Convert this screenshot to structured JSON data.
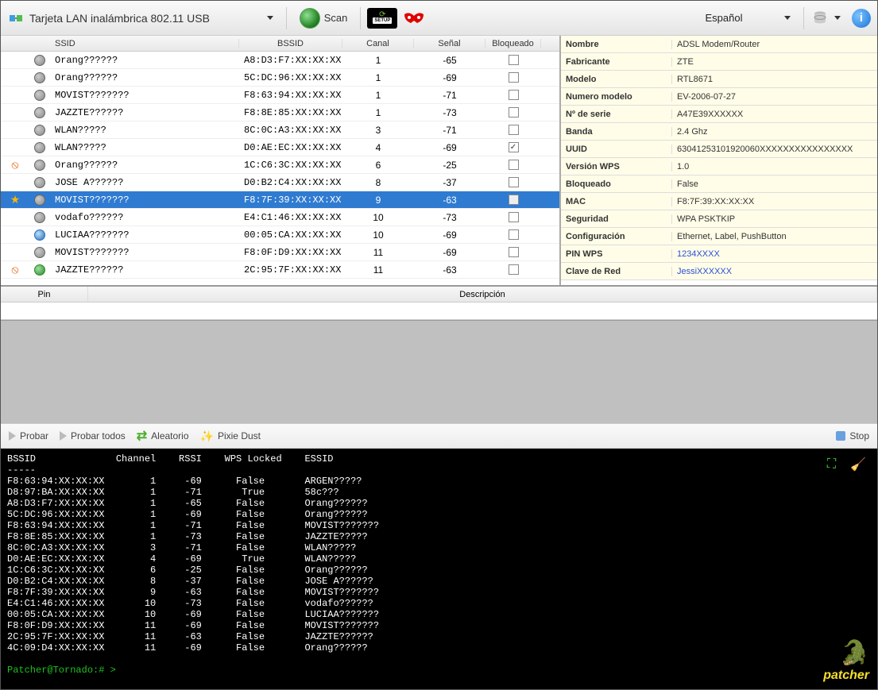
{
  "toolbar": {
    "adapter": "Tarjeta LAN inalámbrica 802.11 USB",
    "scan": "Scan",
    "language": "Español"
  },
  "grid": {
    "headers": {
      "ssid": "SSID",
      "bssid": "BSSID",
      "channel": "Canal",
      "signal": "Señal",
      "locked": "Bloqueado"
    },
    "rows": [
      {
        "ic1": "",
        "ic2": "dot",
        "ssid": "Orang??????",
        "bssid": "A8:D3:F7:XX:XX:XX",
        "ch": "1",
        "sig": "-65",
        "lock": false,
        "sel": false
      },
      {
        "ic1": "",
        "ic2": "dot",
        "ssid": "Orang??????",
        "bssid": "5C:DC:96:XX:XX:XX",
        "ch": "1",
        "sig": "-69",
        "lock": false,
        "sel": false
      },
      {
        "ic1": "",
        "ic2": "dot",
        "ssid": "MOVIST???????",
        "bssid": "F8:63:94:XX:XX:XX",
        "ch": "1",
        "sig": "-71",
        "lock": false,
        "sel": false
      },
      {
        "ic1": "",
        "ic2": "dot",
        "ssid": "JAZZTE??????",
        "bssid": "F8:8E:85:XX:XX:XX",
        "ch": "1",
        "sig": "-73",
        "lock": false,
        "sel": false
      },
      {
        "ic1": "",
        "ic2": "dot",
        "ssid": "WLAN?????",
        "bssid": "8C:0C:A3:XX:XX:XX",
        "ch": "3",
        "sig": "-71",
        "lock": false,
        "sel": false
      },
      {
        "ic1": "",
        "ic2": "dot",
        "ssid": "WLAN?????",
        "bssid": "D0:AE:EC:XX:XX:XX",
        "ch": "4",
        "sig": "-69",
        "lock": true,
        "sel": false
      },
      {
        "ic1": "no",
        "ic2": "dot",
        "ssid": "Orang??????",
        "bssid": "1C:C6:3C:XX:XX:XX",
        "ch": "6",
        "sig": "-25",
        "lock": false,
        "sel": false
      },
      {
        "ic1": "",
        "ic2": "dot",
        "ssid": "JOSE A??????",
        "bssid": "D0:B2:C4:XX:XX:XX",
        "ch": "8",
        "sig": "-37",
        "lock": false,
        "sel": false
      },
      {
        "ic1": "star",
        "ic2": "dot",
        "ssid": "MOVIST???????",
        "bssid": "F8:7F:39:XX:XX:XX",
        "ch": "9",
        "sig": "-63",
        "lock": false,
        "sel": true
      },
      {
        "ic1": "",
        "ic2": "dot",
        "ssid": "vodafo??????",
        "bssid": "E4:C1:46:XX:XX:XX",
        "ch": "10",
        "sig": "-73",
        "lock": false,
        "sel": false
      },
      {
        "ic1": "",
        "ic2": "globe",
        "ssid": "LUCIAA???????",
        "bssid": "00:05:CA:XX:XX:XX",
        "ch": "10",
        "sig": "-69",
        "lock": false,
        "sel": false
      },
      {
        "ic1": "",
        "ic2": "dot",
        "ssid": "MOVIST???????",
        "bssid": "F8:0F:D9:XX:XX:XX",
        "ch": "11",
        "sig": "-69",
        "lock": false,
        "sel": false
      },
      {
        "ic1": "no",
        "ic2": "green",
        "ssid": "JAZZTE??????",
        "bssid": "2C:95:7F:XX:XX:XX",
        "ch": "11",
        "sig": "-63",
        "lock": false,
        "sel": false
      }
    ]
  },
  "props": [
    {
      "k": "Nombre",
      "v": "ADSL Modem/Router"
    },
    {
      "k": "Fabricante",
      "v": "ZTE"
    },
    {
      "k": "Modelo",
      "v": "RTL8671"
    },
    {
      "k": "Numero modelo",
      "v": "EV-2006-07-27"
    },
    {
      "k": "Nº de serie",
      "v": "A47E39XXXXXX"
    },
    {
      "k": "Banda",
      "v": "2.4 Ghz"
    },
    {
      "k": "UUID",
      "v": "63041253101920060XXXXXXXXXXXXXXXX"
    },
    {
      "k": "Versión WPS",
      "v": "1.0"
    },
    {
      "k": "Bloqueado",
      "v": "False"
    },
    {
      "k": "MAC",
      "v": "F8:7F:39:XX:XX:XX"
    },
    {
      "k": "Seguridad",
      "v": "WPA PSKTKIP"
    },
    {
      "k": "Configuración",
      "v": "Ethernet, Label, PushButton"
    },
    {
      "k": "PIN WPS",
      "v": "1234XXXX",
      "link": true
    },
    {
      "k": "Clave de Red",
      "v": "JessiXXXXXX",
      "link": true
    }
  ],
  "pin": {
    "h1": "Pin",
    "h2": "Descripción"
  },
  "actions": {
    "probar": "Probar",
    "probar_todos": "Probar todos",
    "aleatorio": "Aleatorio",
    "pixie": "Pixie Dust",
    "stop": "Stop"
  },
  "terminal": {
    "header": "BSSID              Channel    RSSI    WPS Locked    ESSID",
    "divider": "-----",
    "lines": [
      "F8:63:94:XX:XX:XX        1     -69      False       ARGEN?????",
      "D8:97:BA:XX:XX:XX        1     -71       True       58c???",
      "A8:D3:F7:XX:XX:XX        1     -65      False       Orang??????",
      "5C:DC:96:XX:XX:XX        1     -69      False       Orang??????",
      "F8:63:94:XX:XX:XX        1     -71      False       MOVIST???????",
      "F8:8E:85:XX:XX:XX        1     -73      False       JAZZTE?????",
      "8C:0C:A3:XX:XX:XX        3     -71      False       WLAN?????",
      "D0:AE:EC:XX:XX:XX        4     -69       True       WLAN?????",
      "1C:C6:3C:XX:XX:XX        6     -25      False       Orang??????",
      "D0:B2:C4:XX:XX:XX        8     -37      False       JOSE A??????",
      "F8:7F:39:XX:XX:XX        9     -63      False       MOVIST???????",
      "E4:C1:46:XX:XX:XX       10     -73      False       vodafo??????",
      "00:05:CA:XX:XX:XX       10     -69      False       LUCIAA???????",
      "F8:0F:D9:XX:XX:XX       11     -69      False       MOVIST???????",
      "2C:95:7F:XX:XX:XX       11     -63      False       JAZZTE??????",
      "4C:09:D4:XX:XX:XX       11     -69      False       Orang??????"
    ],
    "prompt": "Patcher@Tornado:# >"
  },
  "logo": "patcher"
}
